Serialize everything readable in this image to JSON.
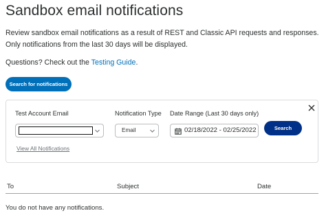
{
  "page": {
    "title": "Sandbox email notifications",
    "description": "Review sandbox email notifications as a result of REST and Classic API requests and responses. Only notifications from the last 30 days will be displayed.",
    "questions_prefix": "Questions? Check out the ",
    "questions_link": "Testing Guide",
    "questions_suffix": ".",
    "search_toggle_label": "Search for notifications"
  },
  "filters": {
    "test_account_email_label": "Test Account Email",
    "test_account_email_value": "",
    "notification_type_label": "Notification Type",
    "notification_type_value": "Email",
    "date_range_label": "Date Range (Last 30 days only)",
    "date_range_value": "02/18/2022 - 02/25/2022",
    "search_button_label": "Search",
    "view_all_label": "View All Notifications",
    "close_icon": "close-icon",
    "calendar_icon": "calendar-icon"
  },
  "table": {
    "columns": [
      "To",
      "Subject",
      "Date"
    ],
    "empty_message": "You do not have any notifications."
  },
  "colors": {
    "primary_button": "#0070ba",
    "search_button": "#003087",
    "link": "#0070ba"
  }
}
